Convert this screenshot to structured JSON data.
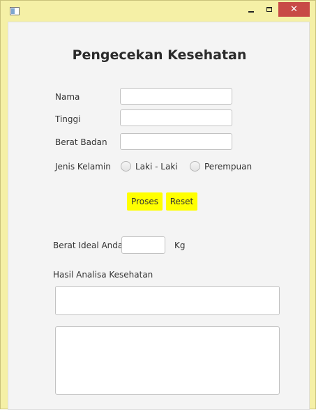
{
  "window": {
    "close_glyph": "✕"
  },
  "form": {
    "title": "Pengecekan Kesehatan",
    "nama_label": "Nama",
    "nama_value": "",
    "tinggi_label": "Tinggi",
    "tinggi_value": "",
    "berat_label": "Berat Badan",
    "berat_value": "",
    "gender_label": "Jenis Kelamin",
    "gender_options": [
      "Laki - Laki",
      "Perempuan"
    ],
    "proses_label": "Proses",
    "reset_label": "Reset",
    "ideal_label": "Berat Ideal Anda",
    "ideal_value": "",
    "unit_label": "Kg",
    "analysis_label": "Hasil Analisa Kesehatan"
  },
  "colors": {
    "window_frame": "#f5f0a6",
    "button_fill": "#ffff00",
    "close_button": "#c84a46"
  }
}
